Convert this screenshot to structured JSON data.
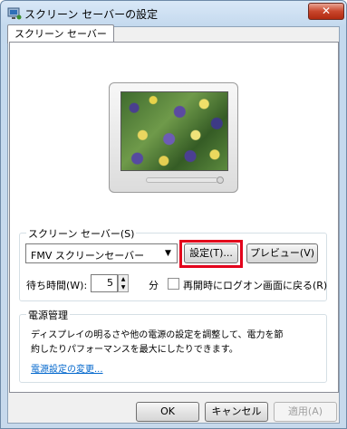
{
  "window": {
    "title": "スクリーン セーバーの設定",
    "close_symbol": "✕"
  },
  "tab": {
    "label": "スクリーン セーバー"
  },
  "screensaver_group": {
    "label": "スクリーン セーバー(S)",
    "selected": "FMV スクリーンセーバー",
    "settings_button": "設定(T)...",
    "preview_button": "プレビュー(V)",
    "wait_label": "待ち時間(W):",
    "wait_value": "5",
    "wait_unit": "分",
    "resume_logon_label": "再開時にログオン画面に戻る(R)",
    "resume_logon_checked": false
  },
  "power_group": {
    "label": "電源管理",
    "description_line1": "ディスプレイの明るさや他の電源の設定を調整して、電力を節",
    "description_line2": "約したりパフォーマンスを最大にしたりできます。",
    "link": "電源設定の変更..."
  },
  "footer": {
    "ok": "OK",
    "cancel": "キャンセル",
    "apply": "適用(A)"
  },
  "colors": {
    "highlight_border": "#e3001b",
    "link": "#0066cc"
  }
}
